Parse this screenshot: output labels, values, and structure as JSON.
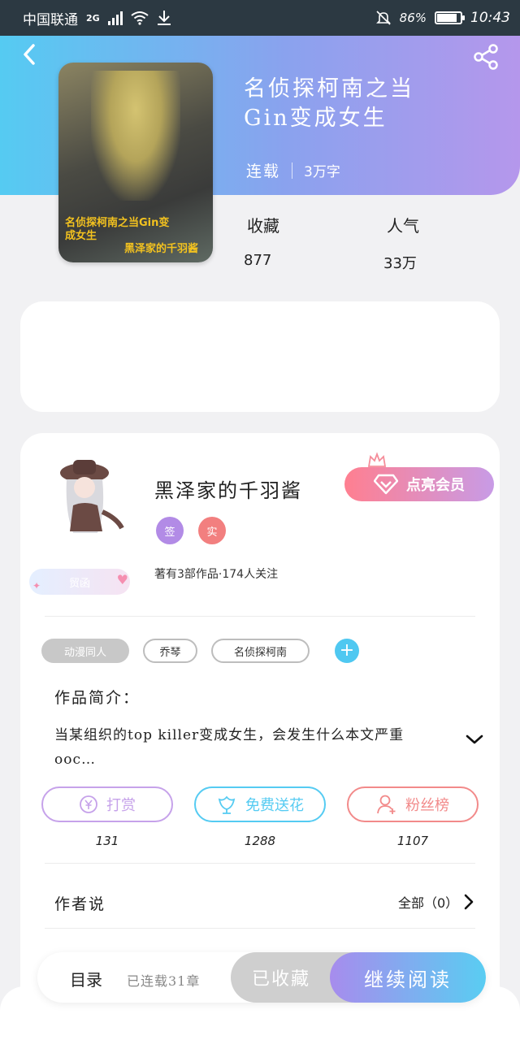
{
  "status_bar": {
    "carrier": "中国联通",
    "network": "2G",
    "battery_percent": "86%",
    "battery_level": 0.86,
    "time": "10:43"
  },
  "book": {
    "title_line1": "名侦探柯南之当",
    "title_line2": "Gin变成女生",
    "status": "连载",
    "word_count": "3万字",
    "cover_text_line1": "名侦探柯南之当Gin变",
    "cover_text_line2": "成女生",
    "cover_text_line3": "黑泽家的千羽酱"
  },
  "stats": {
    "favorites_label": "收藏",
    "favorites_value": "877",
    "popularity_label": "人气",
    "popularity_value": "33万"
  },
  "author": {
    "name": "黑泽家的千羽酱",
    "badge_sign": "签",
    "badge_real": "实",
    "stats_text": "著有3部作品·174人关注",
    "follow_label": "贸函",
    "vip_label": "点亮会员"
  },
  "tags": [
    "动漫同人",
    "乔琴",
    "名侦探柯南"
  ],
  "intro": {
    "heading": "作品简介：",
    "text": "当某组织的top killer变成女生，会发生什么本文严重ooc…"
  },
  "actions": [
    {
      "label": "打赏",
      "count": "131",
      "color": "#c6a2ea"
    },
    {
      "label": "免费送花",
      "count": "1288",
      "color": "#55cbf2"
    },
    {
      "label": "粉丝榜",
      "count": "1107",
      "color": "#f28a8a"
    }
  ],
  "author_says": {
    "label": "作者说",
    "all_label": "全部（0）"
  },
  "bottom": {
    "toc_label": "目录",
    "chapters_label": "已连载31章",
    "collected_label": "已收藏",
    "read_label": "继续阅读"
  },
  "colors": {
    "header_start": "#55cbf2",
    "header_end": "#b597ec",
    "vip_start": "#ff7f90",
    "vip_end": "#c89be6"
  }
}
